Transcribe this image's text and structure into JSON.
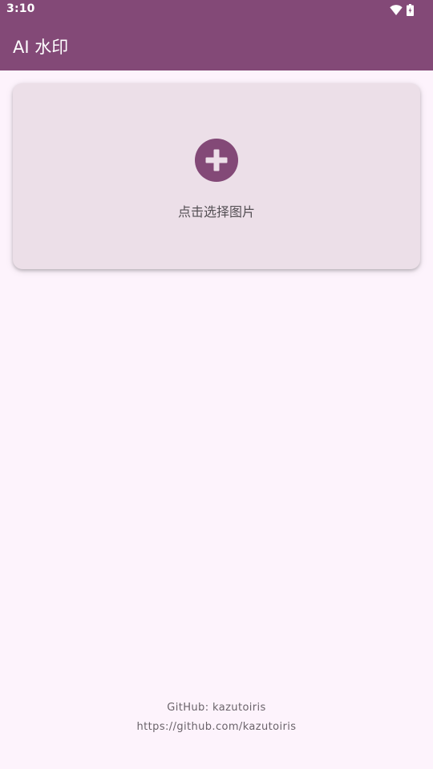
{
  "status_bar": {
    "time": "3:10",
    "icons": [
      "wifi-icon",
      "battery-icon"
    ]
  },
  "app_bar": {
    "title": "AI 水印"
  },
  "picker": {
    "icon": "add-circle-icon",
    "label": "点击选择图片"
  },
  "footer": {
    "github": "GitHub: kazutoiris",
    "url": "https://github.com/kazutoiris"
  },
  "colors": {
    "primary": "#834977",
    "background": "#fdf3fc",
    "card": "#ecdfe8",
    "text_secondary": "#555055"
  }
}
